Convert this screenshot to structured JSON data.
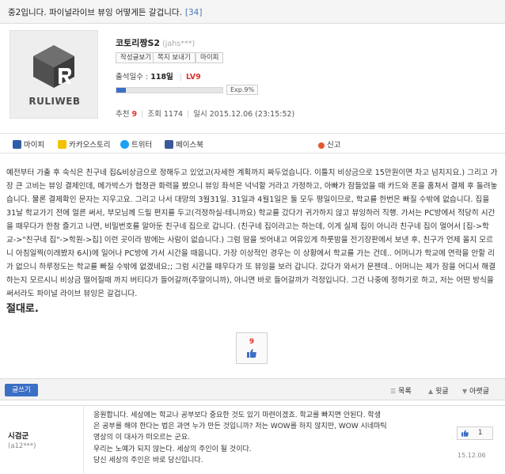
{
  "post": {
    "title": "중2입니다. 파이널라이브 뷰잉 어떻게든 갈겁니다.",
    "comment_count": "[34]"
  },
  "profile": {
    "logo_text": "RULIWEB",
    "nickname": "코토리짱S2",
    "user_id": "(jahs***)",
    "buttons": [
      "작성글보기",
      "쪽지 보내기",
      "마이피"
    ],
    "attendance_label": "출석일수 :",
    "attendance_value": "118일",
    "level": "LV9",
    "exp_label": "Exp.9%",
    "exp_fraction": 0.09
  },
  "meta": {
    "recommend_label": "추천",
    "recommend_value": "9",
    "views_label": "조회",
    "views_value": "1174",
    "date_label": "일시",
    "date_value": "2015.12.06 (23:15:52)"
  },
  "share": {
    "mypi": "마이피",
    "kakao": "카카오스토리",
    "twitter": "트위터",
    "facebook": "페이스북",
    "report": "신고"
  },
  "body": {
    "text": "예전부터 가출 후 숙식은 친구네 집&비상금으로 정해두고 있었고(자세한 계획까지 짜두었습니다. 이틀치 비상금으로 15만원이면 차고 넘치지요.) 그리고 가장 큰 고비는 뷰잉 결제인데, 메가박스가 협정관 화력을 봤으니 뷰잉 좌석은 넉넉할 거라고 가정하고, 아빠가 잠들었을 때 카드와 폰을 훔쳐서 결제 후 돌려놓습니다. 물론 결제확인 문자는 지우고요. 그리고 나서 대망의 3월31일. 31일과 4월1일은 둘 모두 평일이므로, 학교를 한번은 빠질 수밖에 없습니다. 집을 31날 학교가기 전에 얼른 써서, 부모님께 드릴 편지를 두고(걱정하실-테니까요) 학교를 갔다가 귀가하지 않고 뷰잉하러 직행. 가서는 PC방에서 적당히 시간을 때우다가 한참 즐기고 나면, 비밀번호를 알아둔 친구네 집으로 갑니다. (친구네 집이라고는 하는데, 이게 실제 집이 아니라 친구네 집이 멀어서 [집->학교->\"친구네 집\"->학원->집] 이런 곳이라 밤에는 사람이 없습니다.) 그럼 땀을 씻어내고 여유있게 하룻밤을 전기장판에서 보낸 후, 친구가 언제 올지 모르니 아침일찍(이래봤자 6시)에 일어나 PC방에 가서 시간을 때웁니다. 가장 이상적인 경우는 이 상황에서 학교를 가는 건데.. 어머니가 학교에 연락을 안할 리가 없으니 하루정도는 학교를 빠질 수밖에 없겠네요;; 그럼 시간을 때우다가 또 뷰잉을 보러 갑니다. 갔다가 와서가 문젠데.. 어머니는 제가 잠을 어디서 해결하는지 모르시니 비상금 떨어질때 까지 버티다가 들어갈까(주말이니까), 아니면 바로 들어갈까가 걱정입니다. 그건 나중에 정하기로 하고, 저는 어떤 방식을 써서라도 파이널 라이브 뷰잉은 갈겁니다.",
    "emphasis": "절대로."
  },
  "vote": {
    "count": "9"
  },
  "footer": {
    "write_label": "글쓰기",
    "list_label": "목록",
    "up_label": "윗글",
    "down_label": "아랫글"
  },
  "comment": {
    "nickname": "시검군",
    "user_id": "(a12***)",
    "lines": [
      "응원합니다. 세상에는 학교나 공부보다 중요한 것도 있기 마련이겠죠. 학교를 빠지면 안된다. 학생",
      "은 공부를 해야 한다는 법은 과연 누가 만든 것입니까? 저는 WOW를 하지 않지만, WOW 시네마틱",
      "영상의 이 대사가 떠오르는 군요.",
      "우리는 노예가 되지 않는다. 세상의 주인이 될 것이다.",
      "당신 세상의 주인은 바로 당신입니다."
    ],
    "vote_count": "1",
    "date": "15.12.06"
  },
  "colors": {
    "accent_blue": "#3b6fc4",
    "accent_red": "#e0312f",
    "title_count_blue": "#4a78b8"
  },
  "icons": {
    "mypi": "mypi-icon",
    "kakao": "kakaostory-icon",
    "twitter": "twitter-icon",
    "facebook": "facebook-icon",
    "report": "report-icon",
    "thumb": "thumbs-up-icon"
  }
}
